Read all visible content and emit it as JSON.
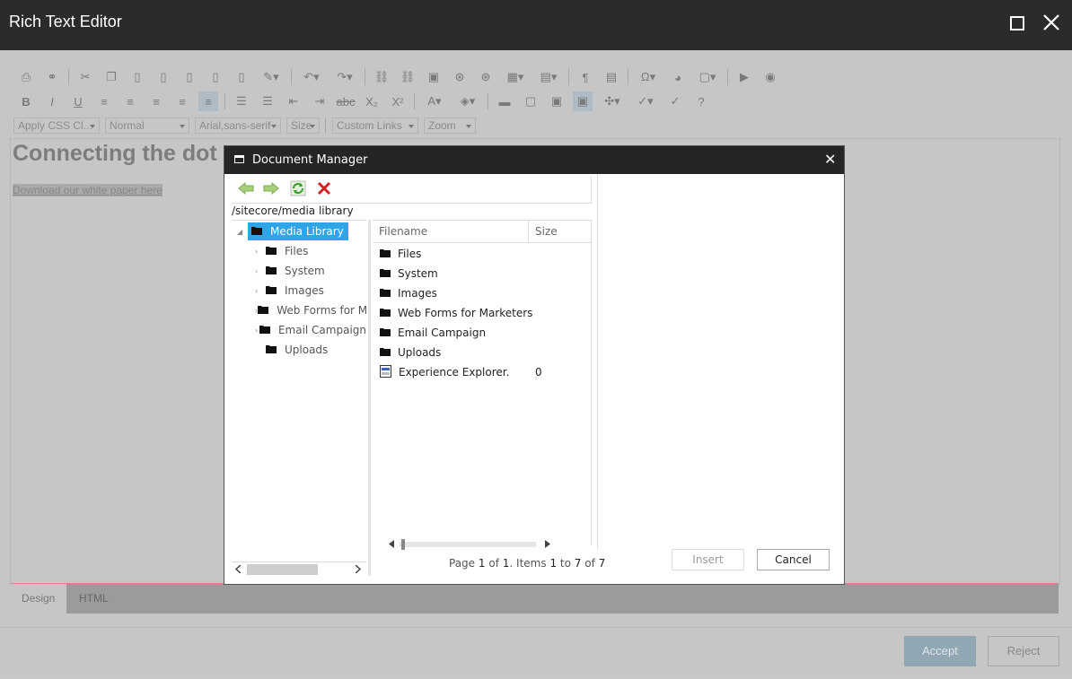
{
  "window": {
    "title": "Rich Text Editor"
  },
  "toolbar": {
    "css_class": "Apply CSS Cl...",
    "paragraph": "Normal",
    "font": "Arial,sans-serif",
    "size": "Size",
    "links": "Custom Links",
    "zoom": "Zoom"
  },
  "editor": {
    "heading": "Connecting the dot",
    "link": "Download our white paper here"
  },
  "tabs": [
    {
      "label": "Design"
    },
    {
      "label": "HTML"
    }
  ],
  "footer": {
    "accept": "Accept",
    "reject": "Reject"
  },
  "dialog": {
    "title": "Document Manager",
    "path": "/sitecore/media library",
    "tree": [
      {
        "label": "Media Library"
      },
      {
        "label": "Files"
      },
      {
        "label": "System"
      },
      {
        "label": "Images"
      },
      {
        "label": "Web Forms for M"
      },
      {
        "label": "Email Campaign"
      },
      {
        "label": "Uploads"
      }
    ],
    "columns": {
      "filename": "Filename",
      "size": "Size"
    },
    "rows": [
      {
        "name": "Files",
        "size": ""
      },
      {
        "name": "System",
        "size": ""
      },
      {
        "name": "Images",
        "size": ""
      },
      {
        "name": "Web Forms for Marketers",
        "size": ""
      },
      {
        "name": "Email Campaign",
        "size": ""
      },
      {
        "name": "Uploads",
        "size": ""
      },
      {
        "name": "Experience Explorer.",
        "size": "0"
      }
    ],
    "pager": {
      "page_word": "Page",
      "page": "1",
      "of_word": "of",
      "pages": "1",
      "items_word": ". Items",
      "from": "1",
      "to_word": "to",
      "to": "7",
      "of_word2": "of",
      "total": "7"
    },
    "insert": "Insert",
    "cancel": "Cancel"
  },
  "colors": {
    "titlebar": "#2b2b2b",
    "selection": "#2fa4e7",
    "accept": "#91a7b4"
  }
}
